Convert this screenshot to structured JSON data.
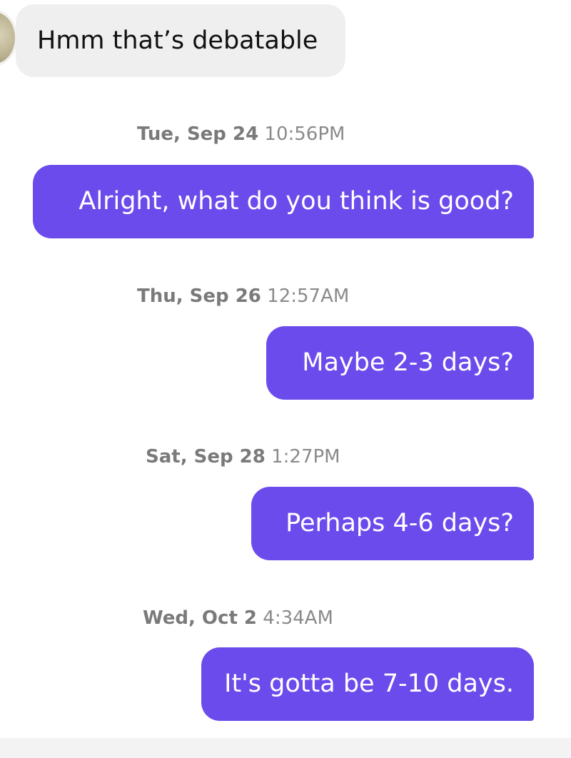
{
  "messages": [
    {
      "direction": "received",
      "text": "Hmm that’s debatable"
    },
    {
      "direction": "sent",
      "day": "Tue, Sep 24",
      "time": "10:56PM",
      "text": "Alright, what do you think is good?"
    },
    {
      "direction": "sent",
      "day": "Thu, Sep 26",
      "time": "12:57AM",
      "text": "Maybe 2-3 days?"
    },
    {
      "direction": "sent",
      "day": "Sat, Sep 28",
      "time": "1:27PM",
      "text": "Perhaps 4-6 days?"
    },
    {
      "direction": "sent",
      "day": "Wed, Oct 2",
      "time": "4:34AM",
      "text": "It's gotta be 7-10 days."
    }
  ],
  "colors": {
    "sent_bubble": "#6c4bec",
    "received_bubble": "#efefef",
    "timestamp": "#8a8a8a"
  }
}
